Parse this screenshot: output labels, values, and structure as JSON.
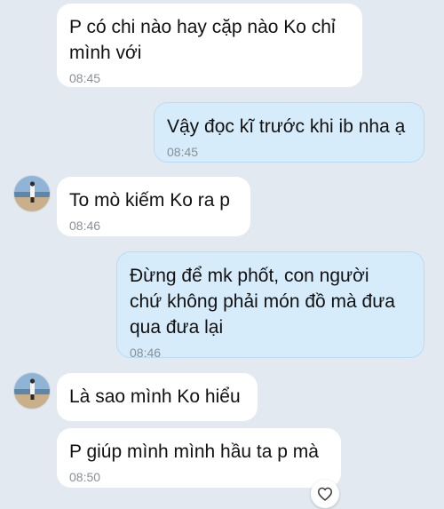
{
  "messages": [
    {
      "text": "P có chi nào hay cặp nào Ko chỉ\nmình với",
      "time": "08:45"
    },
    {
      "text": "Vậy đọc kĩ trước khi ib nha ạ",
      "time": "08:45"
    },
    {
      "text": "To mò kiếm Ko ra p",
      "time": "08:46"
    },
    {
      "text": "Đừng để mk phốt, con người\nchứ không phải món đồ mà đưa\nqua đưa lại",
      "time": "08:46"
    },
    {
      "text": "Là sao mình Ko hiểu",
      "time": ""
    },
    {
      "text": "P giúp mình mình hầu ta p mà",
      "time": "08:50"
    }
  ],
  "icons": {
    "avatar": "profile-photo-beach",
    "reaction": "heart-icon"
  },
  "colors": {
    "background": "#e3e9f0",
    "incoming_bubble": "#ffffff",
    "outgoing_bubble": "#d6ecfb",
    "timestamp": "#8a8f96"
  }
}
